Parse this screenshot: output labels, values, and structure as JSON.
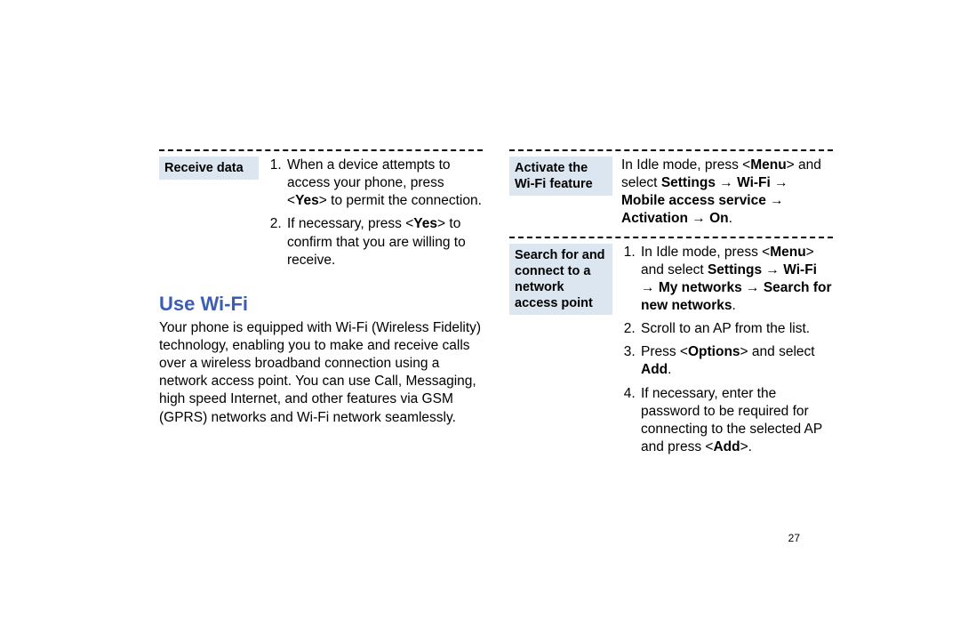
{
  "left": {
    "receiveDataLabel": "Receive data",
    "receiveStep1_part1": "When a device attempts to access your phone, press <",
    "receiveStep1_bold": "Yes",
    "receiveStep1_part2": "> to permit the connection.",
    "receiveStep2_part1": "If necessary, press <",
    "receiveStep2_bold": "Yes",
    "receiveStep2_part2": "> to confirm that you are willing to receive.",
    "heading": "Use Wi-Fi",
    "body": "Your phone is equipped with Wi-Fi (Wireless Fidelity) technology, enabling you to make and receive calls over a wireless broadband connection using a network access point. You can use Call, Messaging, high speed Internet, and other features via GSM (GPRS) networks and Wi-Fi network seamlessly."
  },
  "right": {
    "activateLabel": "Activate the Wi-Fi feature",
    "activate_part1": "In Idle mode, press <",
    "activate_bold1": "Menu",
    "activate_part2": "> and select ",
    "activate_bold2": "Settings",
    "activate_arrow1": " → ",
    "activate_bold3": "Wi-Fi",
    "activate_arrow2": " → ",
    "activate_bold4": "Mobile access service",
    "activate_arrow3": " → ",
    "activate_bold5": "Activation",
    "activate_arrow4": " → ",
    "activate_bold6": "On",
    "activate_end": ".",
    "searchLabel": "Search for and connect to a network access point",
    "search1_part1": "In Idle mode, press <",
    "search1_bold1": "Menu",
    "search1_part2": "> and select ",
    "search1_bold2": "Settings",
    "search1_arrow1": " → ",
    "search1_bold3": "Wi-Fi",
    "search1_arrow2": " → ",
    "search1_bold4": "My networks",
    "search1_arrow3": " → ",
    "search1_bold5": "Search for new networks",
    "search1_end": ".",
    "search2": "Scroll to an AP from the list.",
    "search3_part1": "Press <",
    "search3_bold1": "Options",
    "search3_part2": "> and select ",
    "search3_bold2": "Add",
    "search3_end": ".",
    "search4_part1": "If necessary, enter the password to be required for connecting to the selected AP and press <",
    "search4_bold": "Add",
    "search4_part2": ">."
  },
  "pageNum": "27"
}
